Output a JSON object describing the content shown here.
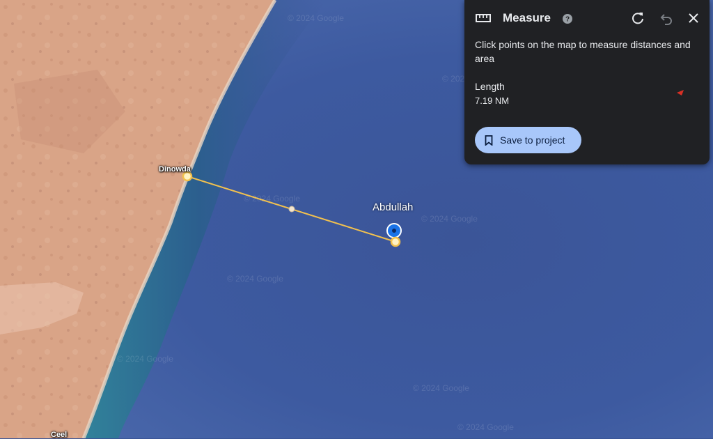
{
  "map": {
    "places": {
      "town_1": "Dinowda",
      "town_2": "Ceel",
      "marker": "Abdullah"
    },
    "watermark": "© 2024 Google",
    "colors": {
      "ocean": "#3a5596",
      "land": "#d8a286",
      "measure_line": "#f2c14e",
      "marker": "#1a73e8"
    }
  },
  "panel": {
    "ruler_icon": "ruler-icon",
    "title": "Measure",
    "help_icon": "help-icon",
    "redo_icon": "refresh-icon",
    "undo_icon": "undo-icon",
    "close_icon": "close-icon",
    "description": "Click points on the map to measure distances and area",
    "length_label": "Length",
    "length_value": "7.19 NM",
    "save_label": "Save to project",
    "save_icon": "bookmark-icon"
  }
}
